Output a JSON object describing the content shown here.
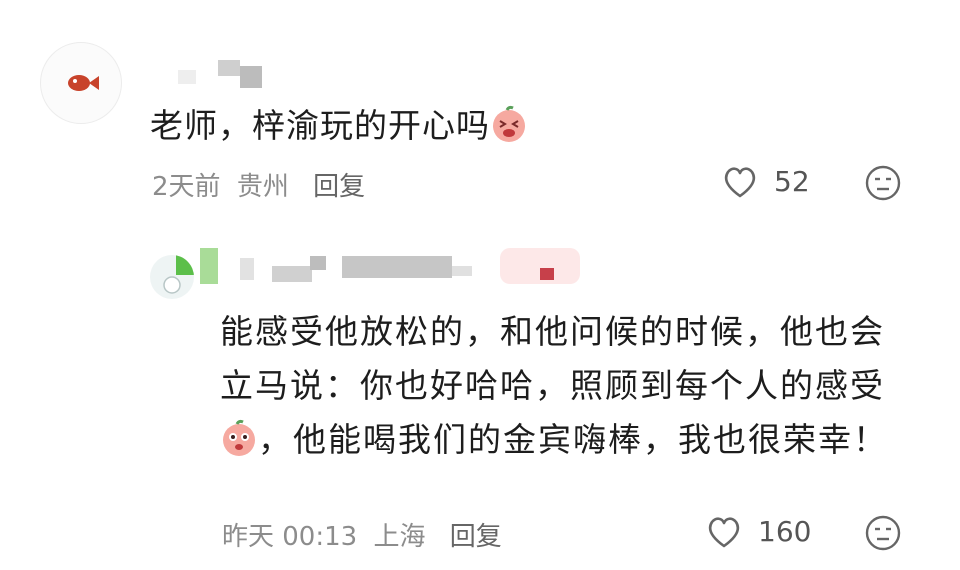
{
  "comments": [
    {
      "text_before": "老师，梓渝玩的开心吗",
      "time": "2天前",
      "location": "贵州",
      "reply_label": "回复",
      "likes": "52"
    }
  ],
  "reply": {
    "text_part1": "能感受他放松的，和他问候的时候，他也会立马说：你也好哈哈，照顾到每个人的感受",
    "text_part2": "，他能喝我们的金宾嗨棒，我也很荣幸！",
    "time": "昨天 00:13",
    "location": "上海",
    "reply_label": "回复",
    "likes": "160"
  },
  "icons": {
    "like": "heart-outline-icon",
    "dislike": "sad-face-icon",
    "emoji_grin": "pink-grin-emoji",
    "emoji_surprise": "pink-surprise-emoji"
  },
  "colors": {
    "meta": "#8c8c8c",
    "text": "#1d1d1d",
    "emoji_pink": "#f6a9a0"
  }
}
